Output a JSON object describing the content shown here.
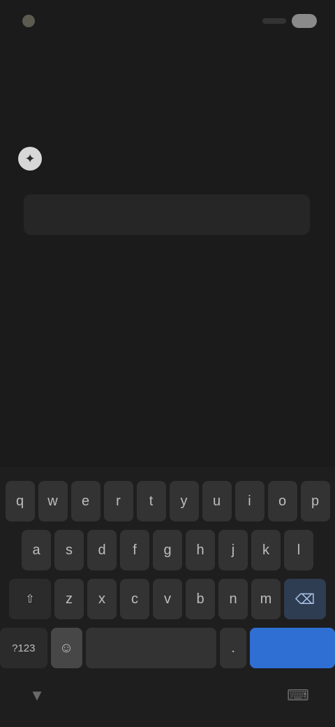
{
  "status_bar": {
    "time": "",
    "battery_icon": "battery-icon"
  },
  "prompt": {
    "avatar_icon": "assistant-icon",
    "avatar_glyph": "✦",
    "text": "",
    "input_value": "",
    "input_placeholder": ""
  },
  "keyboard": {
    "row1": [
      "q",
      "w",
      "e",
      "r",
      "t",
      "y",
      "u",
      "i",
      "o",
      "p"
    ],
    "row2": [
      "a",
      "s",
      "d",
      "f",
      "g",
      "h",
      "j",
      "k",
      "l"
    ],
    "row3": [
      "⇧",
      "z",
      "x",
      "c",
      "v",
      "b",
      "n",
      "m",
      "⌫"
    ],
    "symbols_label": "?123",
    "emoji_glyph": "☺",
    "space_label": "",
    "period_label": ".",
    "enter_label": ""
  },
  "nav_bar": {
    "left_icon": "keyboard-hide-icon",
    "left_glyph": "▼",
    "right_icon": "keyboard-switch-icon",
    "right_glyph": "⌨"
  },
  "colors": {
    "background": "#1b1b1b",
    "key": "#333333",
    "enter_key": "#2f6fd3",
    "input_field": "#262626"
  }
}
